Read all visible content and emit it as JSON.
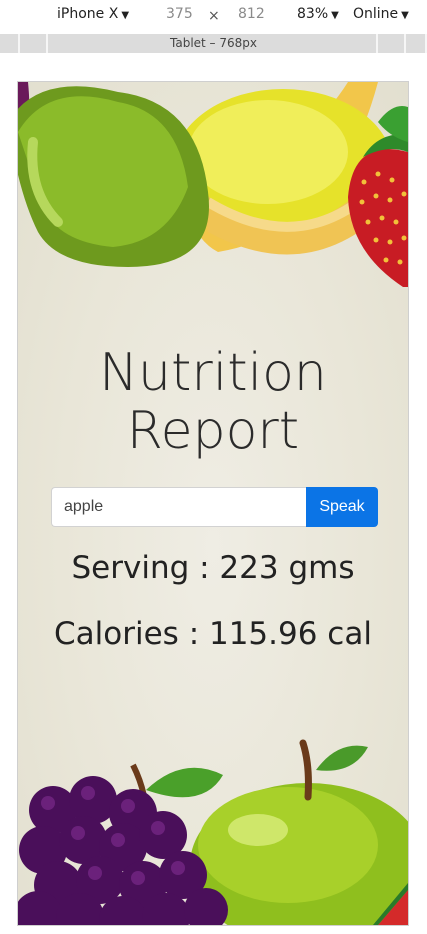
{
  "devtools": {
    "device": "iPhone X",
    "width": "375",
    "times": "×",
    "height": "812",
    "zoom": "83%",
    "network": "Online",
    "caret": "▼",
    "breakpoint_label": "Tablet – 768px"
  },
  "app": {
    "title_line1": "Nutrition",
    "title_line2": "Report",
    "search_value": "apple",
    "speak_label": "Speak",
    "serving": "Serving : 223 gms",
    "calories": "Calories : 115.96 cal"
  },
  "colors": {
    "accent": "#0b74e6",
    "background": "#e9e6d8"
  }
}
